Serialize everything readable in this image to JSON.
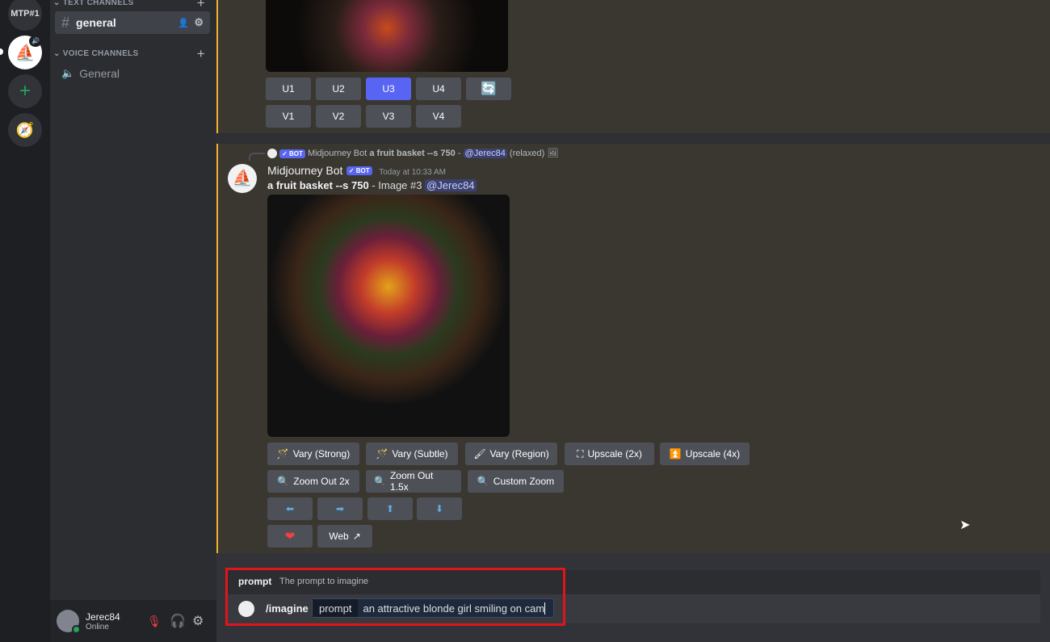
{
  "servers": {
    "label": "MTP#1"
  },
  "sidebar": {
    "text_category": "TEXT CHANNELS",
    "voice_category": "VOICE CHANNELS",
    "text_channels": [
      {
        "name": "general"
      }
    ],
    "voice_channels": [
      {
        "name": "General"
      }
    ]
  },
  "user": {
    "name": "Jerec84",
    "status": "Online"
  },
  "grid_message": {
    "upscale": [
      "U1",
      "U2",
      "U3",
      "U4"
    ],
    "variation": [
      "V1",
      "V2",
      "V3",
      "V4"
    ],
    "selected": "U3"
  },
  "message": {
    "reply_author": "Midjourney Bot",
    "reply_prompt": "a fruit basket --s 750",
    "reply_sep": " - ",
    "reply_mention": "@Jerec84",
    "reply_mode": "(relaxed)",
    "author": "Midjourney Bot",
    "bot_tag": "✓ BOT",
    "timestamp": "Today at 10:33 AM",
    "prompt": "a fruit basket --s 750",
    "image_label": " - Image #3 ",
    "mention": "@Jerec84",
    "buttons_row1": [
      "Vary (Strong)",
      "Vary (Subtle)",
      "Vary (Region)",
      "Upscale (2x)",
      "Upscale (4x)"
    ],
    "buttons_row2": [
      "Zoom Out 2x",
      "Zoom Out 1.5x",
      "Custom Zoom"
    ],
    "arrows": [
      "⬅",
      "➡",
      "⬆",
      "⬇"
    ],
    "web_label": "Web"
  },
  "composer": {
    "option_name": "prompt",
    "option_desc": "The prompt to imagine",
    "command": "/imagine",
    "param_label": "prompt",
    "value": "an attractive blonde girl smiling on cam"
  },
  "colors": {
    "accent": "#5865f2",
    "highlight_border": "#f0b232",
    "annotation": "#e0141c"
  }
}
